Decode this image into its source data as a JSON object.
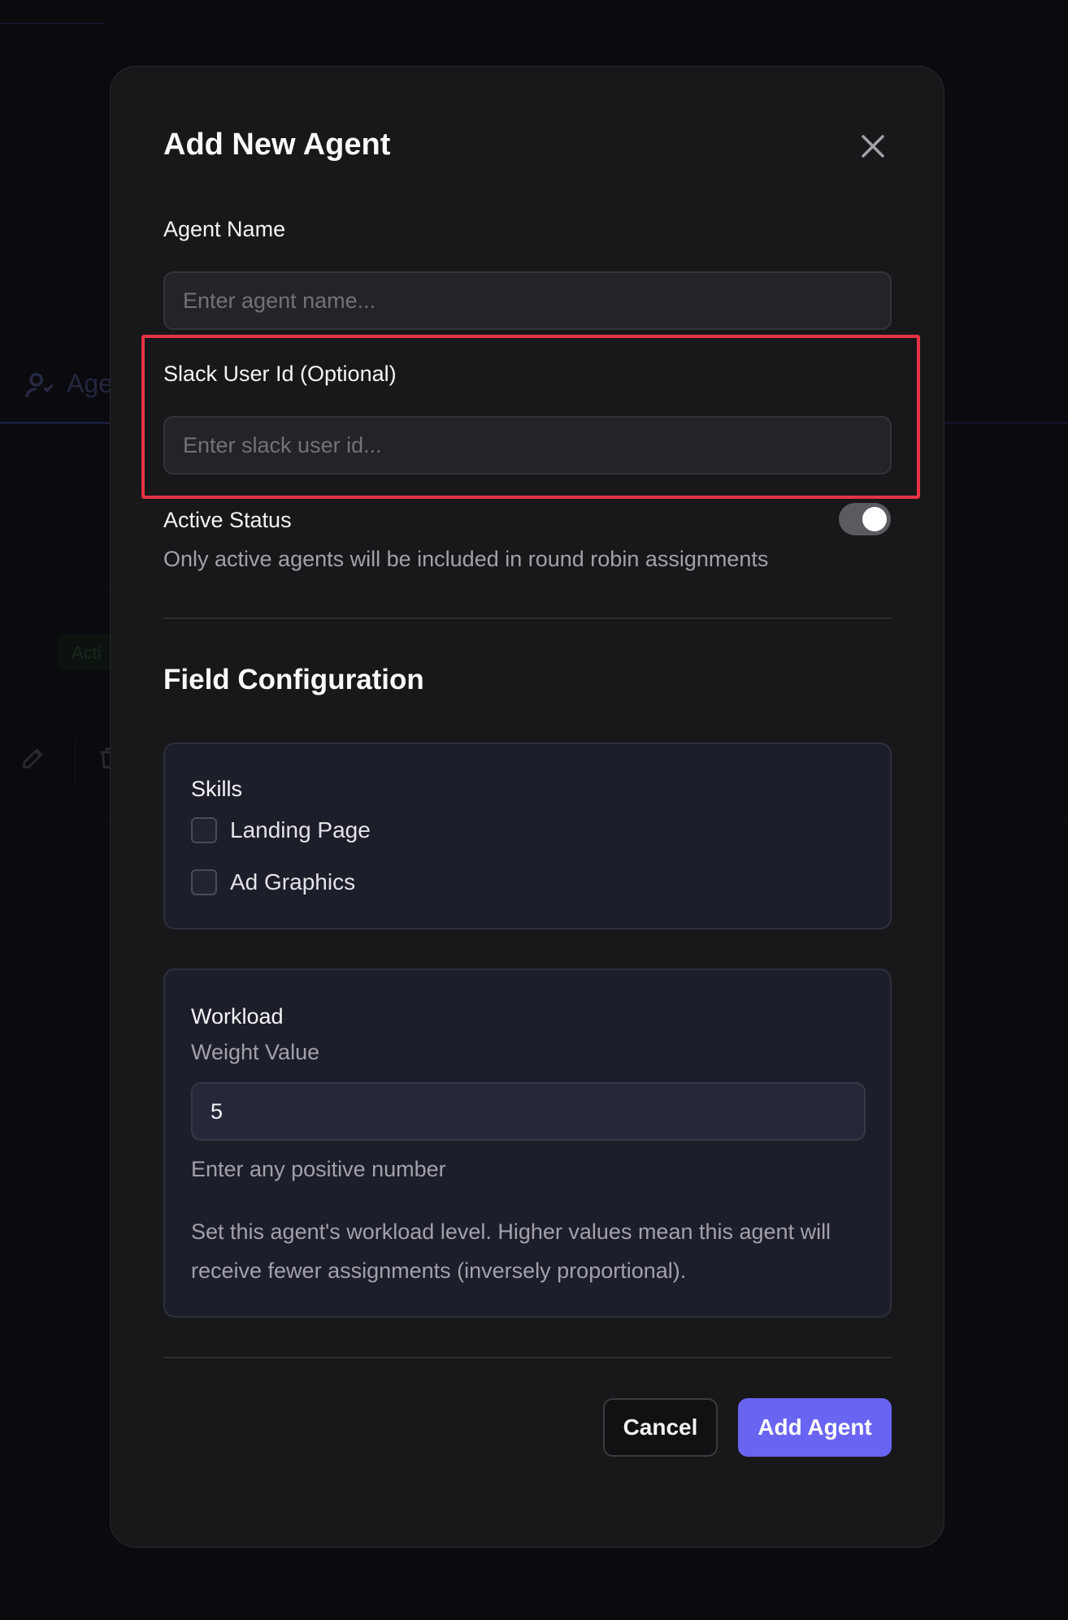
{
  "background": {
    "tab_label": "Age",
    "badge_label": "Acti"
  },
  "modal": {
    "title": "Add New Agent",
    "agent_name": {
      "label": "Agent Name",
      "placeholder": "Enter agent name...",
      "value": ""
    },
    "slack_user_id": {
      "label": "Slack User Id (Optional)",
      "placeholder": "Enter slack user id...",
      "value": ""
    },
    "active_status": {
      "label": "Active Status",
      "description": "Only active agents will be included in round robin assignments",
      "enabled": true
    },
    "field_configuration": {
      "title": "Field Configuration",
      "skills": {
        "title": "Skills",
        "options": [
          {
            "label": "Landing Page",
            "checked": false
          },
          {
            "label": "Ad Graphics",
            "checked": false
          }
        ]
      },
      "workload": {
        "title": "Workload",
        "sublabel": "Weight Value",
        "value": "5",
        "hint": "Enter any positive number",
        "description": "Set this agent's workload level. Higher values mean this agent will receive fewer assignments (inversely proportional)."
      }
    },
    "buttons": {
      "cancel": "Cancel",
      "submit": "Add Agent"
    }
  },
  "colors": {
    "accent": "#6a64f2",
    "highlight": "#e83245",
    "modal_bg": "#18181b",
    "page_bg": "#0c0c11"
  }
}
